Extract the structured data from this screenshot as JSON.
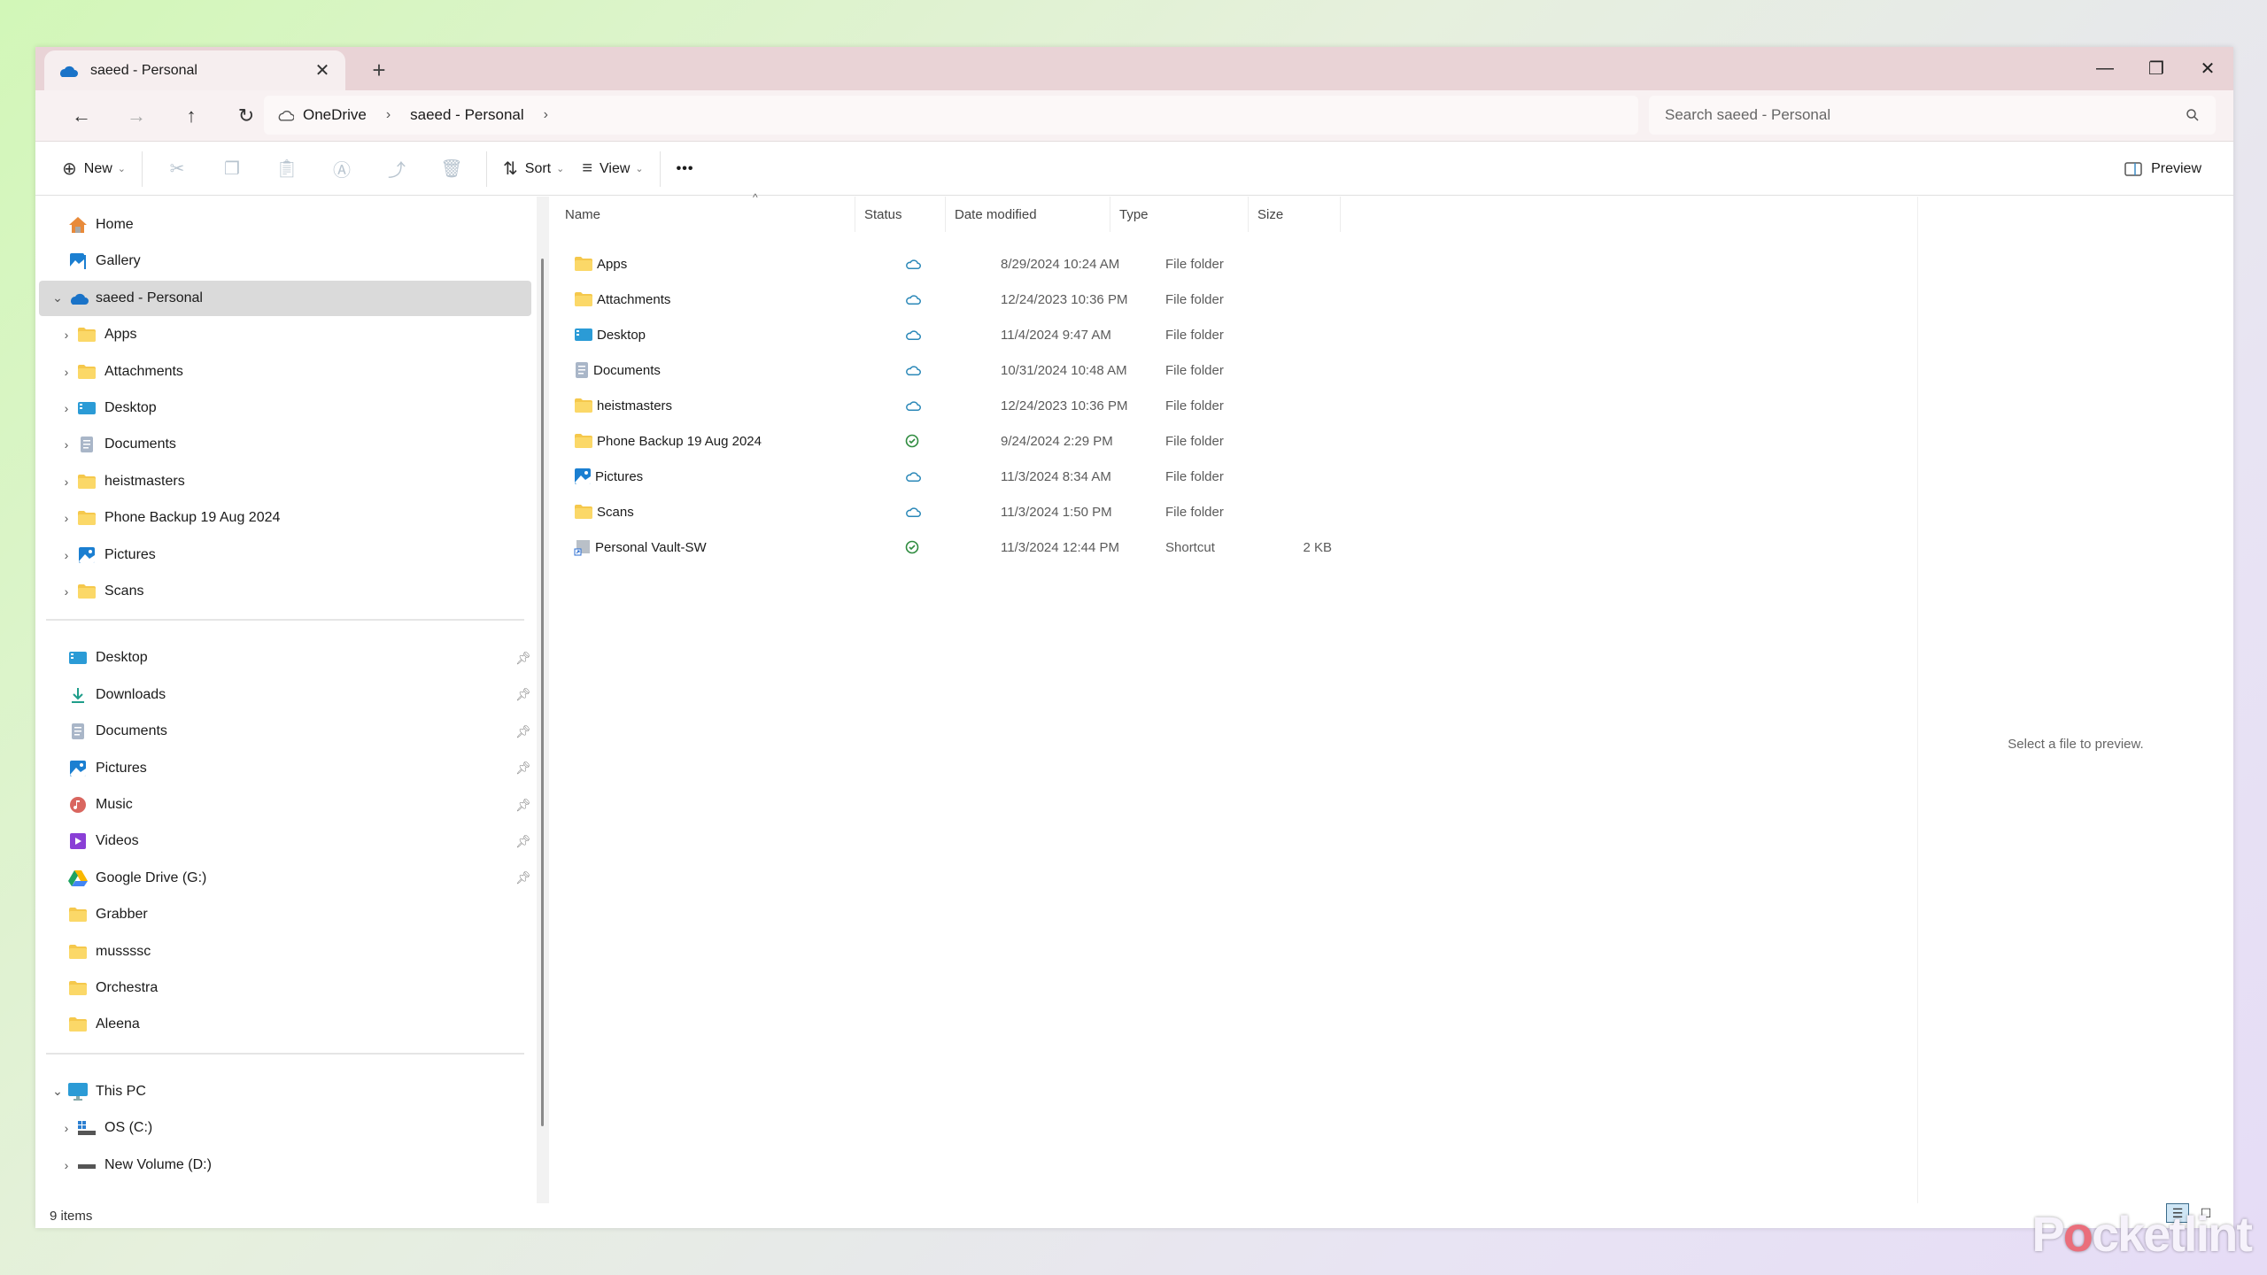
{
  "window": {
    "tab_title": "saeed - Personal",
    "new_tab_label": "+",
    "controls": {
      "minimize": "—",
      "maximize": "❐",
      "close": "✕"
    }
  },
  "address": {
    "breadcrumbs": [
      "OneDrive",
      "saeed - Personal"
    ],
    "search_placeholder": "Search saeed - Personal"
  },
  "toolbar": {
    "new_label": "New",
    "sort_label": "Sort",
    "view_label": "View",
    "more_label": "•••",
    "preview_label": "Preview"
  },
  "sidebar": {
    "top": [
      {
        "label": "Home",
        "icon": "home-icon"
      },
      {
        "label": "Gallery",
        "icon": "gallery-icon"
      },
      {
        "label": "saeed - Personal",
        "icon": "onedrive-icon",
        "expanded": true,
        "selected": true
      }
    ],
    "onedrive_children": [
      {
        "label": "Apps",
        "icon": "folder-icon"
      },
      {
        "label": "Attachments",
        "icon": "folder-icon"
      },
      {
        "label": "Desktop",
        "icon": "desktop-icon"
      },
      {
        "label": "Documents",
        "icon": "documents-icon"
      },
      {
        "label": "heistmasters",
        "icon": "folder-icon"
      },
      {
        "label": "Phone Backup 19 Aug 2024",
        "icon": "folder-icon"
      },
      {
        "label": "Pictures",
        "icon": "pictures-icon"
      },
      {
        "label": "Scans",
        "icon": "folder-icon"
      }
    ],
    "quick_access": [
      {
        "label": "Desktop",
        "icon": "desktop-icon",
        "pinned": true
      },
      {
        "label": "Downloads",
        "icon": "downloads-icon",
        "pinned": true
      },
      {
        "label": "Documents",
        "icon": "documents-icon",
        "pinned": true
      },
      {
        "label": "Pictures",
        "icon": "pictures-icon",
        "pinned": true
      },
      {
        "label": "Music",
        "icon": "music-icon",
        "pinned": true
      },
      {
        "label": "Videos",
        "icon": "videos-icon",
        "pinned": true
      },
      {
        "label": "Google Drive (G:)",
        "icon": "google-drive-icon",
        "pinned": true
      },
      {
        "label": "Grabber",
        "icon": "folder-icon",
        "pinned": false
      },
      {
        "label": "mussssc",
        "icon": "folder-icon",
        "pinned": false
      },
      {
        "label": "Orchestra",
        "icon": "folder-icon",
        "pinned": false
      },
      {
        "label": "Aleena",
        "icon": "folder-icon",
        "pinned": false
      }
    ],
    "this_pc": {
      "label": "This PC",
      "children": [
        {
          "label": "OS (C:)",
          "icon": "os-drive-icon"
        },
        {
          "label": "New Volume (D:)",
          "icon": "drive-icon"
        }
      ]
    }
  },
  "file_list": {
    "columns": [
      "Name",
      "Status",
      "Date modified",
      "Type",
      "Size"
    ],
    "rows": [
      {
        "name": "Apps",
        "icon": "folder-icon",
        "status": "cloud",
        "date": "8/29/2024 10:24 AM",
        "type": "File folder",
        "size": ""
      },
      {
        "name": "Attachments",
        "icon": "folder-icon",
        "status": "cloud",
        "date": "12/24/2023 10:36 PM",
        "type": "File folder",
        "size": ""
      },
      {
        "name": "Desktop",
        "icon": "desktop-icon",
        "status": "cloud",
        "date": "11/4/2024 9:47 AM",
        "type": "File folder",
        "size": ""
      },
      {
        "name": "Documents",
        "icon": "documents-icon",
        "status": "cloud",
        "date": "10/31/2024 10:48 AM",
        "type": "File folder",
        "size": ""
      },
      {
        "name": "heistmasters",
        "icon": "folder-icon",
        "status": "cloud",
        "date": "12/24/2023 10:36 PM",
        "type": "File folder",
        "size": ""
      },
      {
        "name": "Phone Backup 19 Aug 2024",
        "icon": "folder-icon",
        "status": "synced",
        "date": "9/24/2024 2:29 PM",
        "type": "File folder",
        "size": ""
      },
      {
        "name": "Pictures",
        "icon": "pictures-icon",
        "status": "cloud",
        "date": "11/3/2024 8:34 AM",
        "type": "File folder",
        "size": ""
      },
      {
        "name": "Scans",
        "icon": "folder-icon",
        "status": "cloud",
        "date": "11/3/2024 1:50 PM",
        "type": "File folder",
        "size": ""
      },
      {
        "name": "Personal Vault-SW",
        "icon": "shortcut-icon",
        "status": "synced",
        "date": "11/3/2024 12:44 PM",
        "type": "Shortcut",
        "size": "2 KB"
      }
    ]
  },
  "preview_pane": {
    "message": "Select a file to preview."
  },
  "status_bar": {
    "item_count": "9 items"
  },
  "watermark": {
    "text_pre": "P",
    "text_mid": "o",
    "text_post": "cketlint"
  },
  "colors": {
    "accent": "#0f6cbd",
    "cloud_status": "#2b88b8",
    "synced_status": "#2e8b3e",
    "folder": "#f5c84c",
    "tabbar": "#e9d3d6",
    "selected": "#dadada"
  }
}
